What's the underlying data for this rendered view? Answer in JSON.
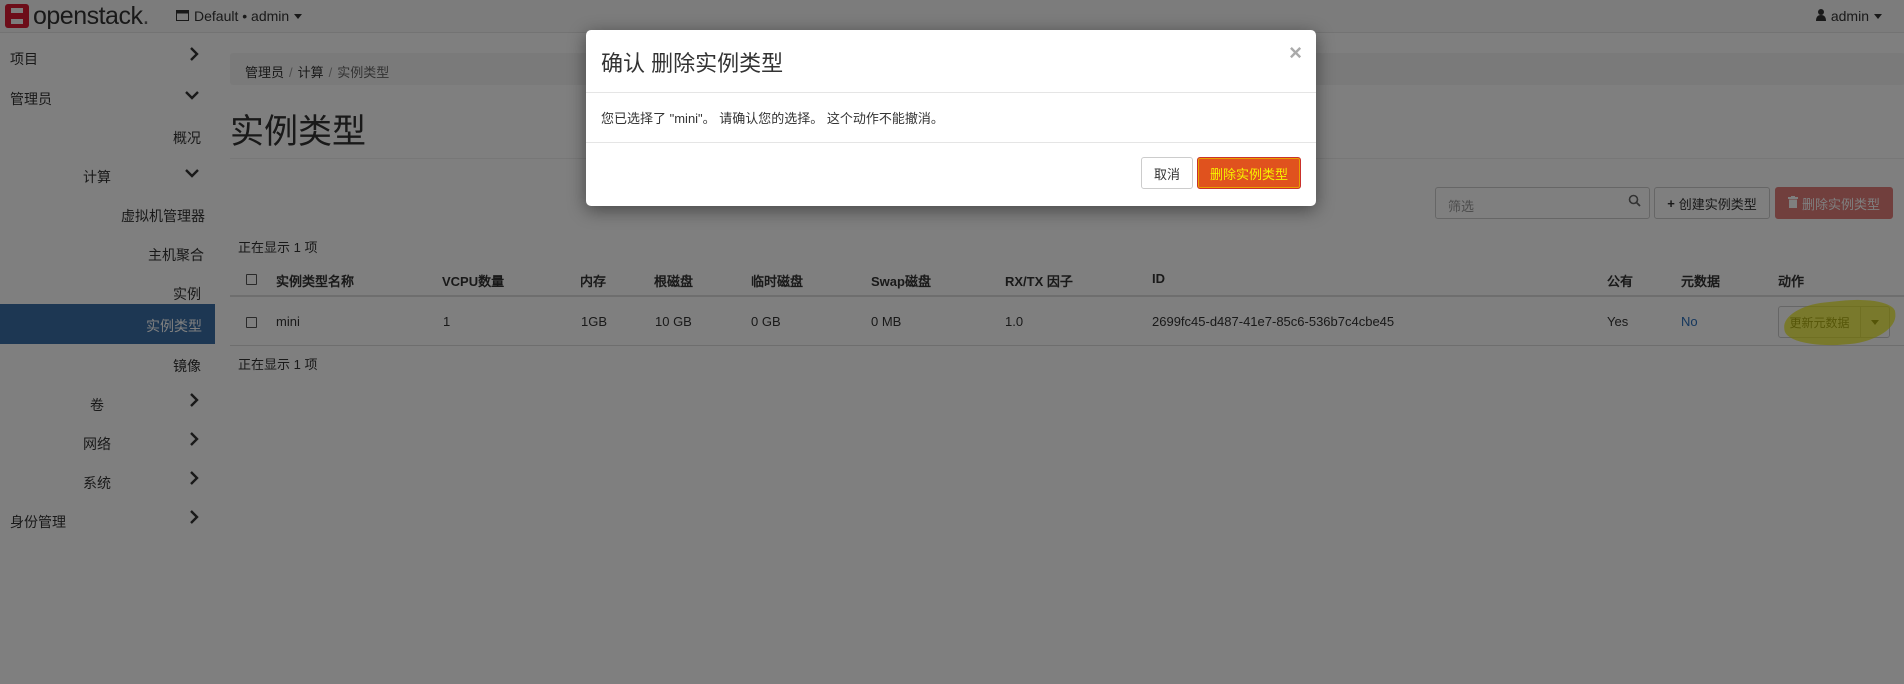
{
  "navbar": {
    "brand": "openstack",
    "brand_dot": ".",
    "project": "Default • admin",
    "user": "admin"
  },
  "sidebar": {
    "project": "项目",
    "admin": "管理员",
    "overview": "概况",
    "compute": "计算",
    "hypervisors": "虚拟机管理器",
    "host_aggregates": "主机聚合",
    "instances": "实例",
    "flavors": "实例类型",
    "images": "镜像",
    "volumes": "卷",
    "network": "网络",
    "system": "系统",
    "identity": "身份管理"
  },
  "breadcrumb": [
    "管理员",
    "计算",
    "实例类型"
  ],
  "page_title": "实例类型",
  "toolbar": {
    "filter_placeholder": "筛选",
    "create_label": "创建实例类型",
    "delete_label": "删除实例类型"
  },
  "table": {
    "count_label": "正在显示 1 项",
    "columns": [
      "实例类型名称",
      "VCPU数量",
      "内存",
      "根磁盘",
      "临时磁盘",
      "Swap磁盘",
      "RX/TX 因子",
      "ID",
      "公有",
      "元数据",
      "动作"
    ],
    "rows": [
      {
        "name": "mini",
        "vcpus": "1",
        "ram": "1GB",
        "root_disk": "10 GB",
        "ephemeral": "0 GB",
        "swap": "0 MB",
        "rxtx": "1.0",
        "id": "2699fc45-d487-41e7-85c6-536b7c4cbe45",
        "public": "Yes",
        "metadata": "No",
        "action": "更新元数据"
      }
    ]
  },
  "modal": {
    "title": "确认 删除实例类型",
    "body": "您已选择了 \"mini\"。 请确认您的选择。 这个动作不能撤消。",
    "cancel": "取消",
    "confirm": "删除实例类型"
  },
  "colors": {
    "sidebar_active": "#3b6fa7",
    "danger": "#d9534f",
    "confirm_button": "#e0521e",
    "confirm_text": "#f7f200",
    "highlight": "#ecec00"
  }
}
